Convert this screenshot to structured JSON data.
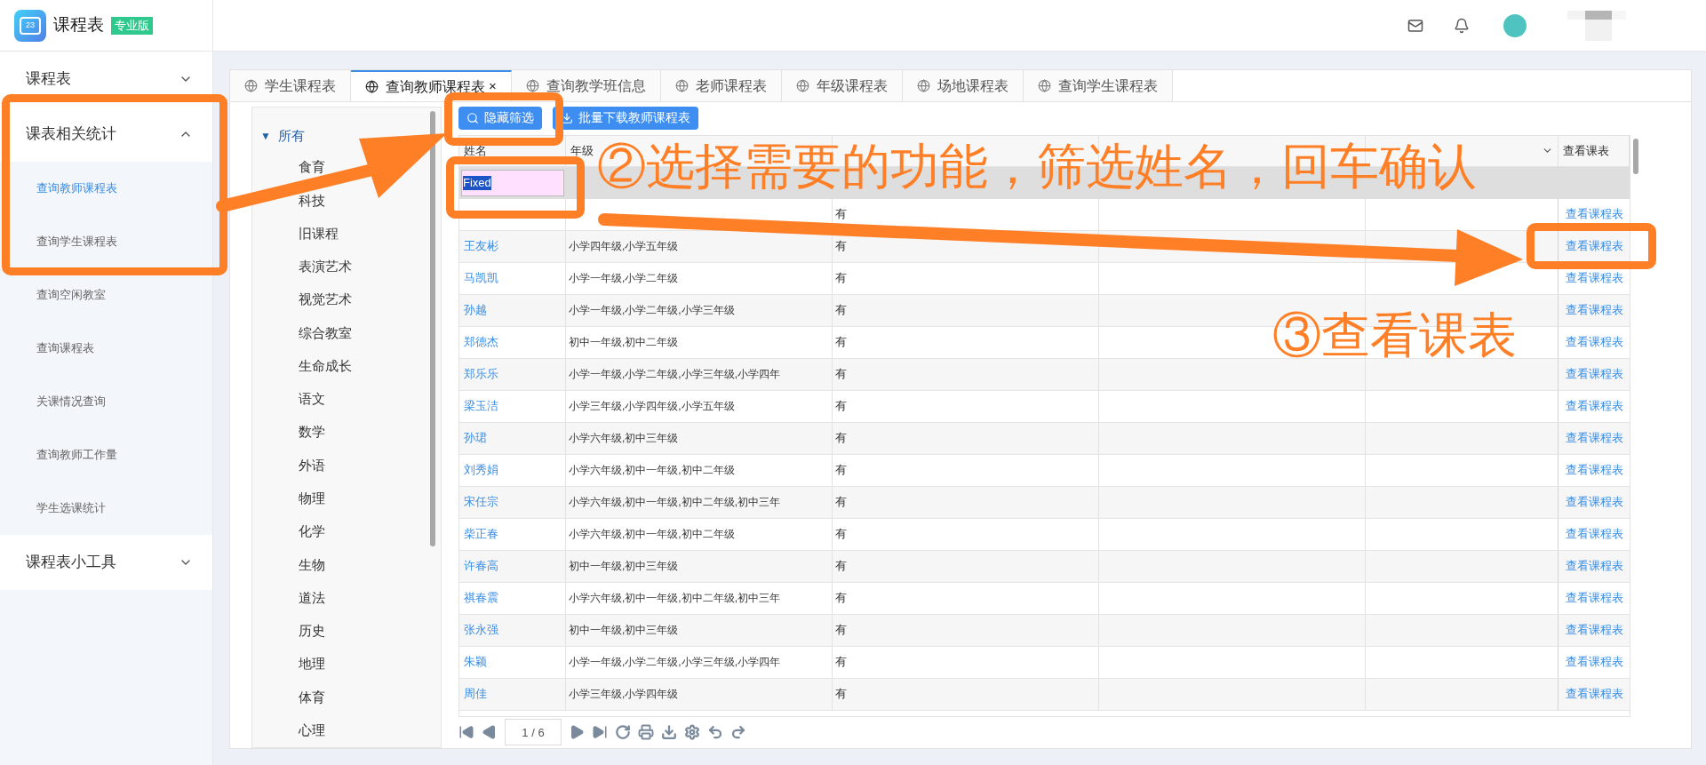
{
  "header": {
    "logo_text": "23",
    "app_name": "课程表",
    "edition_badge": "专业版"
  },
  "sidebar": {
    "groups": [
      {
        "label": "课程表",
        "expanded": false
      },
      {
        "label": "课表相关统计",
        "expanded": true,
        "children": [
          {
            "label": "查询教师课程表",
            "selected": true
          },
          {
            "label": "查询学生课程表",
            "selected": false
          },
          {
            "label": "查询空闲教室",
            "selected": false
          },
          {
            "label": "查询课程表",
            "selected": false
          },
          {
            "label": "关课情况查询",
            "selected": false
          },
          {
            "label": "查询教师工作量",
            "selected": false
          },
          {
            "label": "学生选课统计",
            "selected": false
          }
        ]
      },
      {
        "label": "课程表小工具",
        "expanded": false
      }
    ]
  },
  "tabs": [
    {
      "label": "学生课程表",
      "selected": false
    },
    {
      "label": "查询教师课程表",
      "selected": true,
      "close": "×"
    },
    {
      "label": "查询教学班信息",
      "selected": false
    },
    {
      "label": "老师课程表",
      "selected": false
    },
    {
      "label": "年级课程表",
      "selected": false
    },
    {
      "label": "场地课程表",
      "selected": false
    },
    {
      "label": "查询学生课程表",
      "selected": false
    }
  ],
  "tree": {
    "toggle": "▼",
    "label": "所有",
    "expanded": true,
    "children": [
      "食育",
      "科技",
      "旧课程",
      "表演艺术",
      "视觉艺术",
      "综合教室",
      "生命成长",
      "语文",
      "数学",
      "外语",
      "物理",
      "化学",
      "生物",
      "道法",
      "历史",
      "地理",
      "体育",
      "心理"
    ]
  },
  "toolbar": [
    {
      "kind": "search",
      "label": "隐藏筛选"
    },
    {
      "kind": "download",
      "label": "批量下载教师课程表"
    }
  ],
  "table": {
    "columns": [
      {
        "kind": "plain",
        "label": "姓名"
      },
      {
        "kind": "plain",
        "label": "年级"
      },
      {
        "kind": "plain"
      },
      {
        "kind": "plain"
      },
      {
        "kind": "dropdown"
      },
      {
        "kind": "plain",
        "label": "查看课表"
      }
    ],
    "filter": {
      "value": "Fixed"
    },
    "rows": [
      {
        "has": "有",
        "action": "查看课程表"
      },
      {
        "name": "王友彬",
        "grades": "小学四年级,小学五年级",
        "has": "有",
        "action": "查看课程表"
      },
      {
        "name": "马凯凯",
        "grades": "小学一年级,小学二年级",
        "has": "有",
        "action": "查看课程表"
      },
      {
        "name": "孙越",
        "grades": "小学一年级,小学二年级,小学三年级",
        "has": "有",
        "action": "查看课程表"
      },
      {
        "name": "郑德杰",
        "grades": "初中一年级,初中二年级",
        "has": "有",
        "action": "查看课程表"
      },
      {
        "name": "郑乐乐",
        "grades": "小学一年级,小学二年级,小学三年级,小学四年",
        "has": "有",
        "action": "查看课程表"
      },
      {
        "name": "梁玉洁",
        "grades": "小学三年级,小学四年级,小学五年级",
        "has": "有",
        "action": "查看课程表"
      },
      {
        "name": "孙珺",
        "grades": "小学六年级,初中三年级",
        "has": "有",
        "action": "查看课程表"
      },
      {
        "name": "刘秀娟",
        "grades": "小学六年级,初中一年级,初中二年级",
        "has": "有",
        "action": "查看课程表"
      },
      {
        "name": "宋任宗",
        "grades": "小学六年级,初中一年级,初中二年级,初中三年",
        "has": "有",
        "action": "查看课程表"
      },
      {
        "name": "柴正春",
        "grades": "小学六年级,初中一年级,初中二年级",
        "has": "有",
        "action": "查看课程表"
      },
      {
        "name": "许春高",
        "grades": "初中一年级,初中三年级",
        "has": "有",
        "action": "查看课程表"
      },
      {
        "name": "祺春震",
        "grades": "小学六年级,初中一年级,初中二年级,初中三年",
        "has": "有",
        "action": "查看课程表"
      },
      {
        "name": "张永强",
        "grades": "初中一年级,初中三年级",
        "has": "有",
        "action": "查看课程表"
      },
      {
        "name": "朱颖",
        "grades": "小学一年级,小学二年级,小学三年级,小学四年",
        "has": "有",
        "action": "查看课程表"
      },
      {
        "name": "周佳",
        "grades": "小学三年级,小学四年级",
        "has": "有",
        "action": "查看课程表"
      }
    ]
  },
  "pager": {
    "page": "1 / 6"
  },
  "annotations": [
    "②选择需要的功能，筛选姓名，回车确认",
    "③查看课表"
  ]
}
